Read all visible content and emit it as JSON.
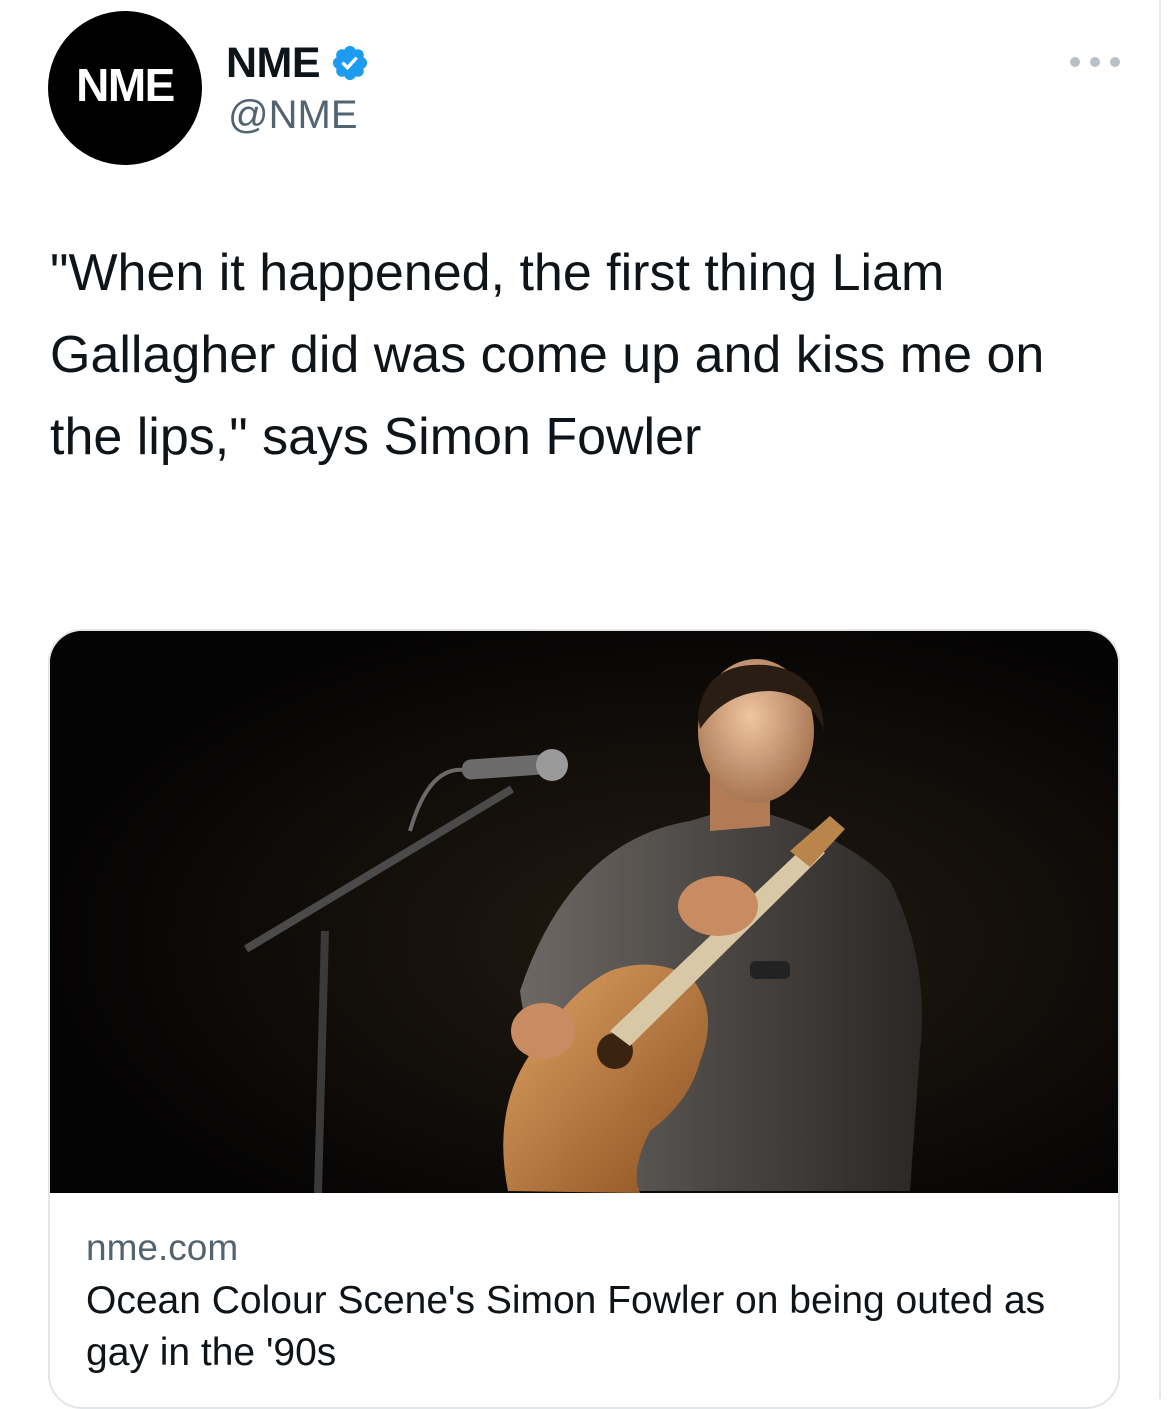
{
  "account": {
    "avatar_text": "NME",
    "display_name": "NME",
    "handle": "@NME",
    "verified": true
  },
  "icons": {
    "verified": "verified-badge-icon",
    "more": "more-options-icon"
  },
  "tweet": {
    "text": "\"When it happened, the first thing Liam Gallagher did was come up and kiss me on the lips,\" says Simon Fowler"
  },
  "card": {
    "domain": "nme.com",
    "title": "Ocean Colour Scene's Simon Fowler on being outed as gay in the '90s"
  },
  "colors": {
    "text_primary": "#0f1419",
    "text_secondary": "#536471",
    "verified_blue": "#1d9bf0",
    "card_border": "#e1e6ea"
  }
}
